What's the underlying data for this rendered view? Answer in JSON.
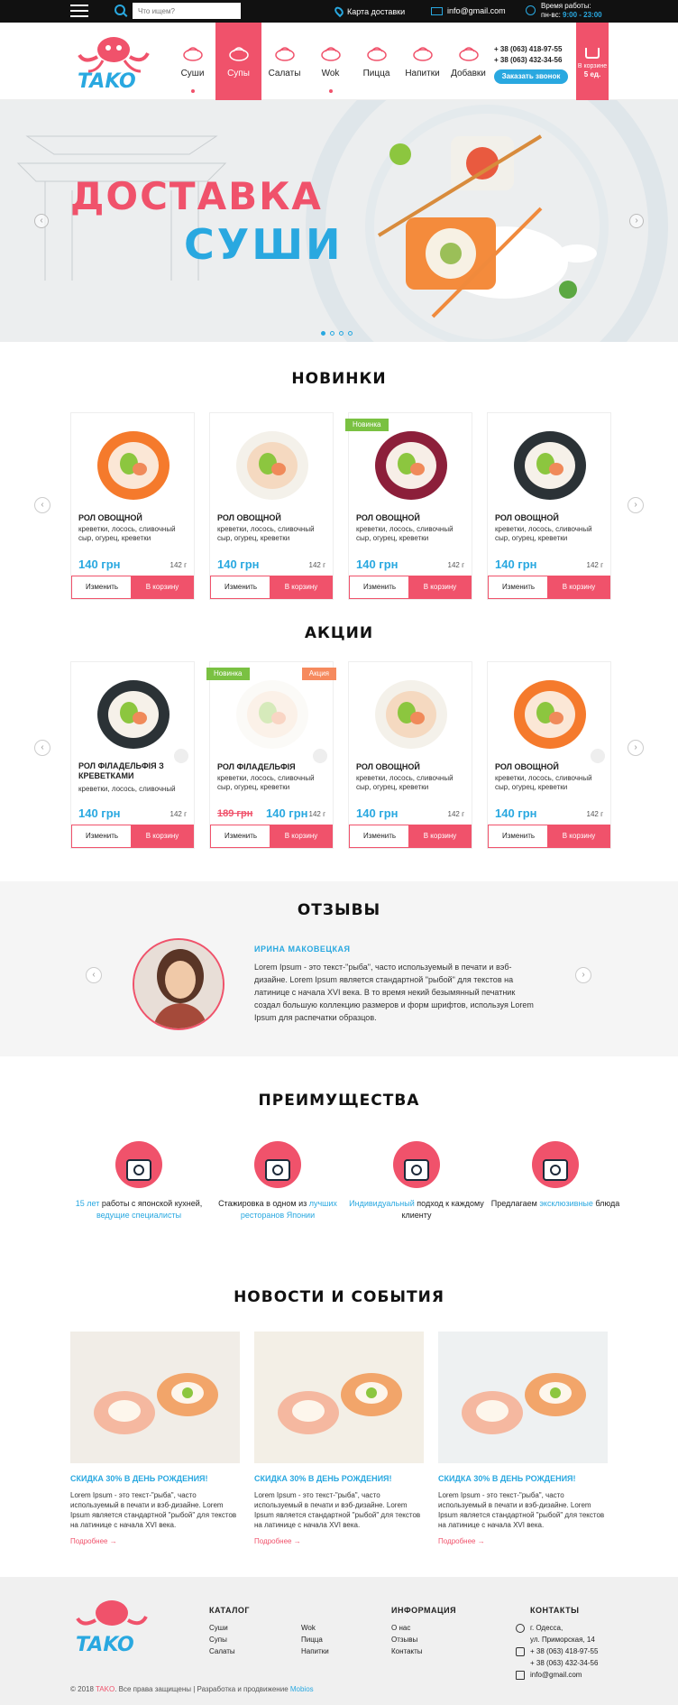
{
  "topbar": {
    "search_placeholder": "Что ищем?",
    "map_label": "Карта доставки",
    "email": "info@gmail.com",
    "hours_label": "Время работы:",
    "hours_days": "пн-вс:",
    "hours_value": "9:00 - 23:00"
  },
  "header": {
    "logo_text": "TAKO",
    "nav": [
      {
        "label": "Суши",
        "active": false
      },
      {
        "label": "Супы",
        "active": true
      },
      {
        "label": "Салаты",
        "active": false
      },
      {
        "label": "Wok",
        "active": false
      },
      {
        "label": "Пицца",
        "active": false
      },
      {
        "label": "Напитки",
        "active": false
      },
      {
        "label": "Добавки",
        "active": false
      }
    ],
    "phone1": "+ 38 (063) 418-97-55",
    "phone2": "+ 38 (063) 432-34-56",
    "call_button": "Заказать звонок",
    "cart_label": "В корзине",
    "cart_count": "5 ед."
  },
  "hero": {
    "title_line1": "ДОСТАВКА",
    "title_line2": "СУШИ"
  },
  "new_section": {
    "title": "НОВИНКИ",
    "items": [
      {
        "name": "РОЛ ОВОЩНОЙ",
        "desc": "креветки, лосось, сливочный сыр, огурец, креветки",
        "price": "140 грн",
        "weight": "142 г",
        "badge": ""
      },
      {
        "name": "РОЛ ОВОЩНОЙ",
        "desc": "креветки, лосось, сливочный сыр, огурец, креветки",
        "price": "140 грн",
        "weight": "142 г",
        "badge": ""
      },
      {
        "name": "РОЛ ОВОЩНОЙ",
        "desc": "креветки, лосось, сливочный сыр, огурец, креветки",
        "price": "140 грн",
        "weight": "142 г",
        "badge": "Новинка"
      },
      {
        "name": "РОЛ ОВОЩНОЙ",
        "desc": "креветки, лосось, сливочный сыр, огурец, креветки",
        "price": "140 грн",
        "weight": "142 г",
        "badge": ""
      }
    ],
    "btn_change": "Изменить",
    "btn_cart": "В корзину"
  },
  "sale_section": {
    "title": "АКЦИИ",
    "items": [
      {
        "name": "РОЛ ФІЛАДЕЛЬФІЯ З КРЕВЕТКАМИ",
        "desc": "креветки, лосось, сливочный",
        "price": "140 грн",
        "old_price": "",
        "weight": "142 г",
        "badge_new": "",
        "badge_sale": ""
      },
      {
        "name": "РОЛ ФІЛАДЕЛЬФІЯ",
        "desc": "креветки, лосось, сливочный сыр, огурец, креветки",
        "price": "140 грн",
        "old_price": "189 грн",
        "weight": "142 г",
        "badge_new": "Новинка",
        "badge_sale": "Акция"
      },
      {
        "name": "РОЛ ОВОЩНОЙ",
        "desc": "креветки, лосось, сливочный сыр, огурец, креветки",
        "price": "140 грн",
        "old_price": "",
        "weight": "142 г",
        "badge_new": "",
        "badge_sale": ""
      },
      {
        "name": "РОЛ ОВОЩНОЙ",
        "desc": "креветки, лосось, сливочный сыр, огурец, креветки",
        "price": "140 грн",
        "old_price": "",
        "weight": "142 г",
        "badge_new": "",
        "badge_sale": ""
      }
    ]
  },
  "reviews": {
    "title": "ОТЗЫВЫ",
    "name": "ИРИНА МАКОВЕЦКАЯ",
    "text": "Lorem Ipsum - это текст-\"рыба\", часто используемый в печати и вэб-дизайне. Lorem Ipsum является стандартной \"рыбой\" для текстов на латинице с начала XVI века. В то время некий безымянный печатник создал большую коллекцию размеров и форм шрифтов, используя Lorem Ipsum для распечатки образцов."
  },
  "advantages": {
    "title": "ПРЕИМУЩЕСТВА",
    "items": [
      {
        "pre": "",
        "hl1": "15 лет",
        "mid": " работы с японской кухней, ",
        "hl2": "ведущие специалисты",
        "post": ""
      },
      {
        "pre": "Стажировка в одном из ",
        "hl1": "лучших ресторанов Японии",
        "mid": "",
        "hl2": "",
        "post": ""
      },
      {
        "pre": "",
        "hl1": "Индивидуальный",
        "mid": " подход к каждому клиенту",
        "hl2": "",
        "post": ""
      },
      {
        "pre": "Предлагаем ",
        "hl1": "эксклюзивные",
        "mid": " блюда",
        "hl2": "",
        "post": ""
      }
    ]
  },
  "news": {
    "title": "НОВОСТИ И СОБЫТИЯ",
    "items": [
      {
        "title": "СКИДКА 30% В ДЕНЬ РОЖДЕНИЯ!",
        "text": "Lorem Ipsum - это текст-\"рыба\", часто используемый в печати и вэб-дизайне. Lorem Ipsum является стандартной \"рыбой\" для текстов на латинице с начала XVI века.",
        "more": "Подробнее"
      },
      {
        "title": "СКИДКА 30% В ДЕНЬ РОЖДЕНИЯ!",
        "text": "Lorem Ipsum - это текст-\"рыба\", часто используемый в печати и вэб-дизайне. Lorem Ipsum является стандартной \"рыбой\" для текстов на латинице с начала XVI века.",
        "more": "Подробнее"
      },
      {
        "title": "СКИДКА 30% В ДЕНЬ РОЖДЕНИЯ!",
        "text": "Lorem Ipsum - это текст-\"рыба\", часто используемый в печати и вэб-дизайне. Lorem Ipsum является стандартной \"рыбой\" для текстов на латинице с начала XVI века.",
        "more": "Подробнее"
      }
    ]
  },
  "footer": {
    "catalog_title": "КАТАЛОГ",
    "catalog_col1": [
      "Суши",
      "Супы",
      "Салаты"
    ],
    "catalog_col2": [
      "Wok",
      "Пицца",
      "Напитки"
    ],
    "info_title": "ИНФОРМАЦИЯ",
    "info_links": [
      "О нас",
      "Отзывы",
      "Контакты"
    ],
    "contacts_title": "КОНТАКТЫ",
    "address1": "г. Одесса,",
    "address2": "ул. Приморская, 14",
    "phone1": "+ 38 (063) 418-97-55",
    "phone2": "+ 38 (063) 432-34-56",
    "email": "info@gmail.com",
    "copy_pre": "© 2018 ",
    "copy_brand": "TAKO",
    "copy_mid": ". Все права защищены | Разработка и продвижение ",
    "copy_dev": "Mobios"
  },
  "colors": {
    "accent_pink": "#f0526b",
    "accent_blue": "#29a8e0",
    "badge_new": "#7ac142",
    "badge_sale": "#f68a5e"
  }
}
